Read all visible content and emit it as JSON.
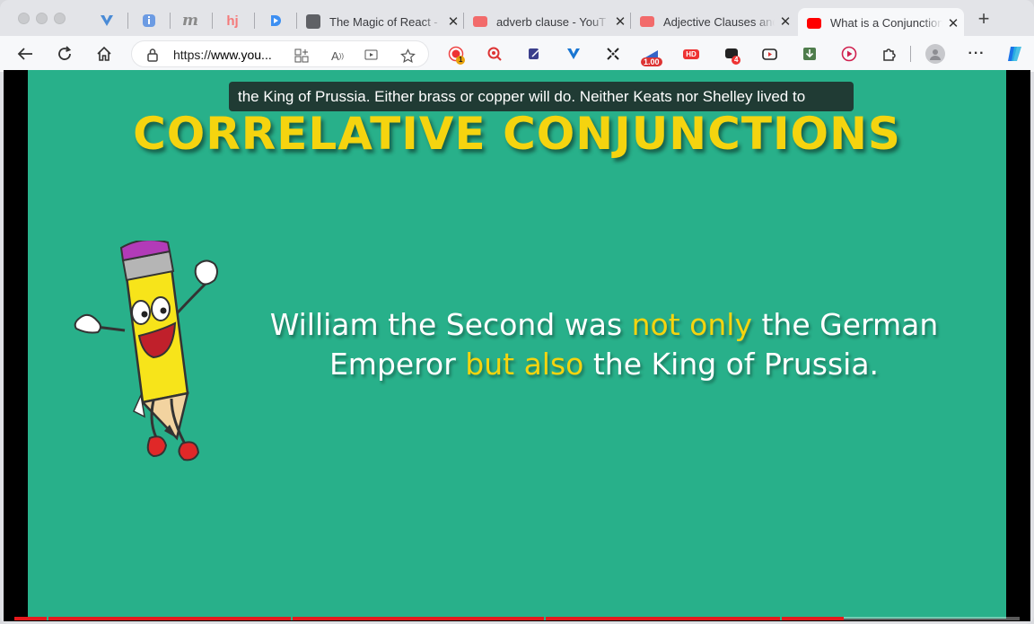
{
  "browser": {
    "pinned_tabs": [
      {
        "icon": "vuetify-icon",
        "glyph": "V",
        "color": "#4a8bd6"
      },
      {
        "icon": "info-icon",
        "glyph": "i",
        "color": "#4a8bd6"
      },
      {
        "icon": "medium-icon",
        "glyph": "m",
        "color": "#8a8a8a"
      },
      {
        "icon": "hotjar-icon",
        "glyph": "hj",
        "color": "#f47a7a"
      },
      {
        "icon": "d-icon",
        "glyph": "D",
        "color": "#3d8ff2"
      }
    ],
    "tabs": [
      {
        "title": "The Magic of React -",
        "favicon": "#5f6166"
      },
      {
        "title": "adverb clause - YouT",
        "favicon": "#f26b6b"
      },
      {
        "title": "Adjective Clauses and",
        "favicon": "#f26b6b"
      },
      {
        "title": "What is a Conjunction",
        "favicon": "#ff0000",
        "active": true
      }
    ],
    "url_prefix": "https://",
    "url_host": "www.you..."
  },
  "extensions": {
    "rec_badge": "1",
    "speed_badge": "1.00",
    "hd_label": "HD",
    "notif_badge": "4"
  },
  "video": {
    "caption": "the King of Prussia. Either brass or copper  will do. Neither Keats nor Shelley lived to",
    "heading": "CORRELATIVE CONJUNCTIONS",
    "sentence_parts": [
      {
        "text": "William the Second was ",
        "highlight": false
      },
      {
        "text": "not only",
        "highlight": true
      },
      {
        "text": " the German Emperor ",
        "highlight": false
      },
      {
        "text": "but also",
        "highlight": true
      },
      {
        "text": " the King of Prussia.",
        "highlight": false
      }
    ],
    "progress": 0.825,
    "heading_color": "#f5d40f",
    "background_color": "#28b08a"
  }
}
